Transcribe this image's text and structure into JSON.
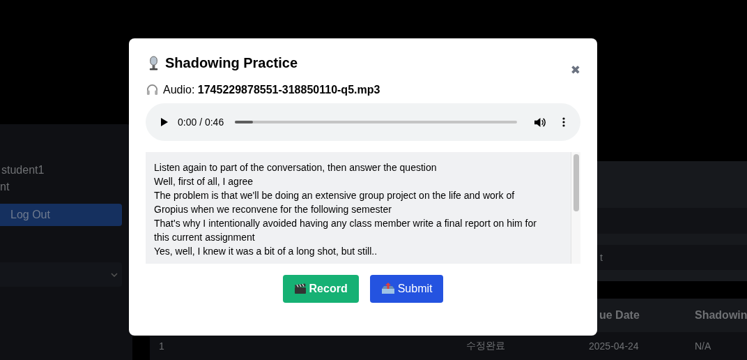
{
  "sidebar": {
    "user_line": "student1",
    "role_line": "nt",
    "logout_button": "Log Out"
  },
  "panel": {
    "row_text": "t"
  },
  "table": {
    "columns": [
      {},
      {},
      {
        "label": "ue Date"
      },
      {
        "label": "Shadowin"
      }
    ],
    "rows": [
      {
        "cells": [
          "1",
          "수정완료",
          "2025-04-24",
          "N/A"
        ]
      }
    ]
  },
  "modal": {
    "title": "Shadowing Practice",
    "close": "✖",
    "audio_label": "Audio:",
    "audio_file": "1745229878551-318850110-q5.mp3",
    "player": {
      "time": "0:00 / 0:46",
      "level": 0.065
    },
    "transcript": [
      "Listen again to part of the conversation, then answer the question",
      "Well, first of all, I agree",
      "The problem is that we'll be doing an extensive group project on the life and work of Gropius when we reconvene for the following semester",
      "That's why I intentionally avoided having any class member write a final report on him for this current assignment",
      "Yes, well, I knew it was a bit of a long shot, but still.."
    ],
    "buttons": [
      {
        "kind": "record",
        "label": "Record"
      },
      {
        "kind": "submit",
        "label": "Submit"
      }
    ]
  }
}
